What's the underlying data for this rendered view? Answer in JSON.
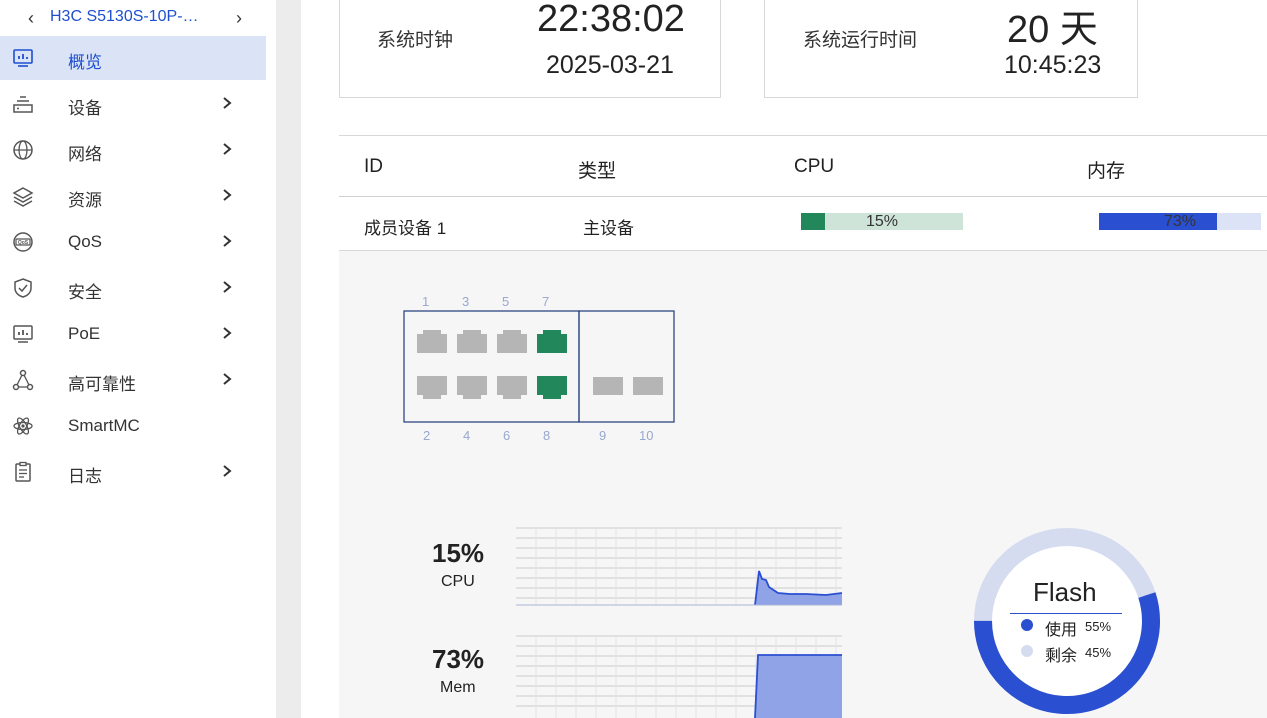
{
  "device": {
    "name": "H3C S5130S-10P-…",
    "prev_icon": "chevron-left-icon",
    "next_icon": "chevron-right-icon"
  },
  "nav": {
    "items": [
      {
        "label": "概览",
        "icon": "monitor-chart-icon",
        "active": true
      },
      {
        "label": "设备",
        "icon": "device-icon"
      },
      {
        "label": "网络",
        "icon": "globe-icon"
      },
      {
        "label": "资源",
        "icon": "layers-icon"
      },
      {
        "label": "QoS",
        "icon": "qos-icon"
      },
      {
        "label": "安全",
        "icon": "shield-icon"
      },
      {
        "label": "PoE",
        "icon": "poe-icon"
      },
      {
        "label": "高可靠性",
        "icon": "topology-icon"
      },
      {
        "label": "SmartMC",
        "icon": "atom-icon"
      },
      {
        "label": "日志",
        "icon": "clipboard-icon"
      }
    ]
  },
  "clock": {
    "label": "系统时钟",
    "time": "22:38:02",
    "date": "2025-03-21"
  },
  "uptime": {
    "label": "系统运行时间",
    "days": "20 天",
    "time": "10:45:23"
  },
  "members": {
    "headers": {
      "id": "ID",
      "type": "类型",
      "cpu": "CPU",
      "mem": "内存"
    },
    "rows": [
      {
        "id": "成员设备 1",
        "type": "主设备",
        "cpu": 15,
        "cpu_text": "15%",
        "mem": 73,
        "mem_text": "73%"
      }
    ]
  },
  "ports": {
    "top_numbers": [
      "1",
      "3",
      "5",
      "7"
    ],
    "bottom_numbers": [
      "2",
      "4",
      "6",
      "8",
      "9",
      "10"
    ],
    "up_ports": [
      "7",
      "8"
    ]
  },
  "stats": {
    "cpu": {
      "value": "15%",
      "label": "CPU"
    },
    "mem": {
      "value": "73%",
      "label": "Mem"
    }
  },
  "flash": {
    "title": "Flash",
    "used_label": "使用",
    "used_value": "55%",
    "free_label": "剩余",
    "free_value": "45%",
    "used_pct": 55
  },
  "colors": {
    "accent": "#1e4fd1",
    "active_bg": "#dbe4f7",
    "cpu_bar": "#22875a",
    "cpu_track": "#cfe4d8",
    "mem_bar": "#2b4fd1",
    "mem_track": "#dde3f7",
    "port_up": "#22875a",
    "port_down": "#b5b5b5",
    "flash_used": "#2b4fd1",
    "flash_free": "#d6dcf0"
  }
}
